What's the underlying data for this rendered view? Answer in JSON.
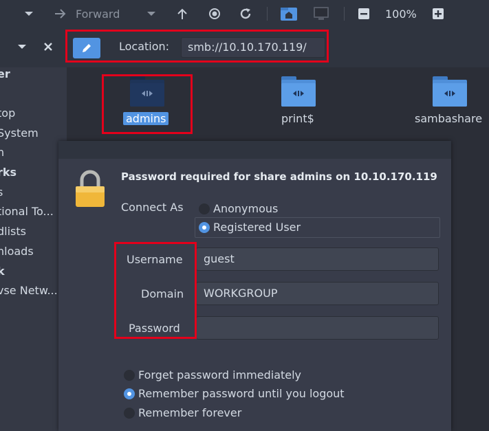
{
  "toolbar": {
    "forward_label": "Forward",
    "zoom_level": "100%"
  },
  "location": {
    "label": "Location:",
    "value": "smb://10.10.170.119/"
  },
  "sidebar": {
    "items": [
      {
        "label": "er",
        "bold": true
      },
      {
        "label": "top",
        "bold": false
      },
      {
        "label": "System",
        "bold": false
      },
      {
        "label": "n",
        "bold": false
      },
      {
        "label": "rks",
        "bold": true
      },
      {
        "label": "s",
        "bold": false
      },
      {
        "label": "tional To...",
        "bold": false
      },
      {
        "label": "dlists",
        "bold": false
      },
      {
        "label": "nloads",
        "bold": false
      },
      {
        "label": "k",
        "bold": true
      },
      {
        "label": "vse Netw...",
        "bold": false
      }
    ]
  },
  "folders": [
    {
      "label": "admins",
      "selected": true
    },
    {
      "label": "print$",
      "selected": false
    },
    {
      "label": "sambashare",
      "selected": false
    }
  ],
  "dialog": {
    "title": "Password required for share admins on 10.10.170.119",
    "connect_as_label": "Connect As",
    "option_anonymous": "Anonymous",
    "option_registered": "Registered User",
    "username_label": "Username",
    "username_value": "guest",
    "domain_label": "Domain",
    "domain_value": "WORKGROUP",
    "password_label": "Password",
    "password_value": "",
    "remember_options": [
      {
        "label": "Forget password immediately",
        "checked": false
      },
      {
        "label": "Remember password until you logout",
        "checked": true
      },
      {
        "label": "Remember forever",
        "checked": false
      }
    ]
  },
  "colors": {
    "accent": "#5294e2",
    "highlight": "#e3001b",
    "background": "#2b2e37",
    "dialog": "#383c4a"
  }
}
